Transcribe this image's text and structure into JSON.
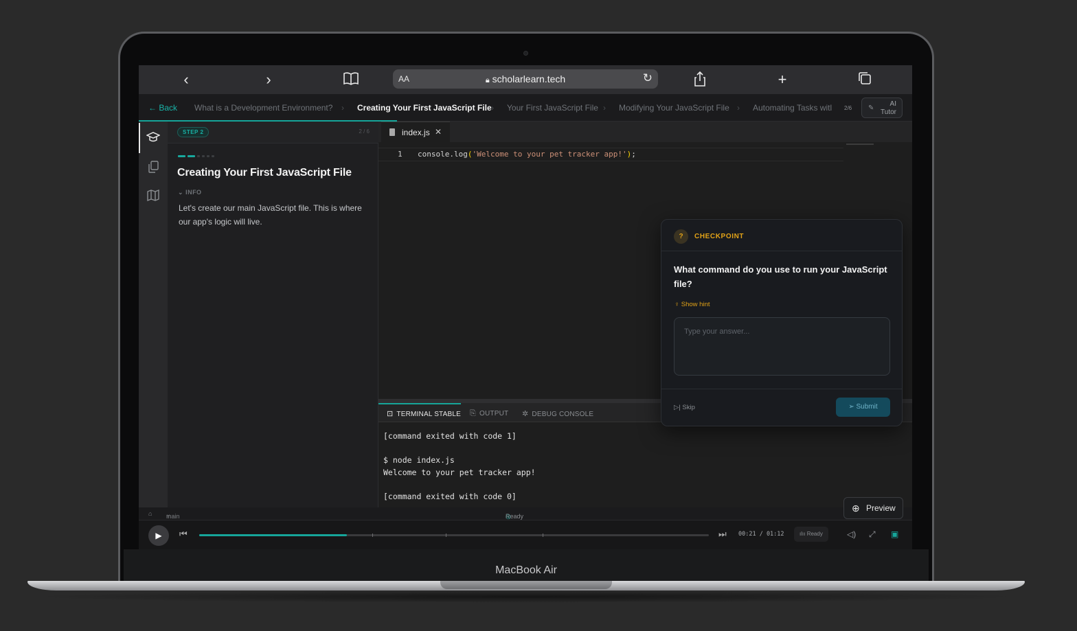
{
  "device": {
    "label": "MacBook Air"
  },
  "browser": {
    "aa": "AA",
    "url": "scholarlearn.tech",
    "icons": {
      "back": "chevron-left-icon",
      "forward": "chevron-right-icon",
      "reader": "book-icon",
      "lock": "lock-icon",
      "reload": "reload-icon",
      "share": "share-icon",
      "new_tab": "plus-icon",
      "tabs": "tabs-icon"
    }
  },
  "breadcrumb": {
    "back": "← Back",
    "items": [
      "What is a Development Environment?",
      "Creating Your First JavaScript File",
      "Your First JavaScript File",
      "Modifying Your JavaScript File",
      "Automating Tasks witl"
    ],
    "current_index": 1,
    "position": "2/6",
    "ai_tutor": "AI Tutor",
    "ai_tutor_line1": "AI",
    "ai_tutor_line2": "Tutor"
  },
  "lesson": {
    "step_badge": "STEP 2",
    "step_count": "2 / 6",
    "title": "Creating Your First JavaScript File",
    "info_label": "INFO",
    "text": "Let's create our main JavaScript file. This is where our app's logic will live."
  },
  "editor": {
    "tab": "index.js",
    "line_number": "1",
    "code_prefix": "console.log",
    "code_open": "(",
    "code_string": "'Welcome to your pet tracker app!'",
    "code_close": ")",
    "code_end": ";"
  },
  "terminal": {
    "tabs": [
      "TERMINAL STABLE",
      "OUTPUT",
      "DEBUG CONSOLE"
    ],
    "output": "[command exited with code 1]\n\n$ node index.js\nWelcome to your pet tracker app!\n\n[command exited with code 0]"
  },
  "status_bar": {
    "branch": "main",
    "state": "Ready"
  },
  "player": {
    "time": "00:21 / 01:12",
    "progress": 0.29,
    "ready": "Ready"
  },
  "checkpoint": {
    "label": "CHECKPOINT",
    "badge": "?",
    "question": "What command do you use to run your JavaScript file?",
    "hint": "Show hint",
    "placeholder": "Type your answer...",
    "skip": "Skip",
    "submit": "Submit"
  },
  "preview_button": "Preview",
  "colors": {
    "accent": "#16a69a",
    "warning": "#e3a317",
    "background": "#1e1e1e"
  }
}
